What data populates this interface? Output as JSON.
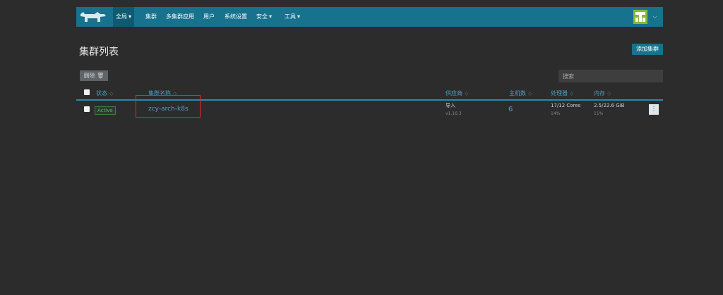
{
  "nav": {
    "items": [
      {
        "label": "全局",
        "active": true,
        "dropdown": true
      },
      {
        "label": "集群"
      },
      {
        "label": "多集群应用"
      },
      {
        "label": "用户"
      },
      {
        "label": "系统设置"
      },
      {
        "label": "安全",
        "dropdown": true
      },
      {
        "label": "工具",
        "dropdown": true
      }
    ],
    "logo_icon": "rancher-logo",
    "brand_color": "#17728d"
  },
  "page": {
    "title": "集群列表",
    "add_button": "添加集群",
    "delete_button": "删除",
    "search_placeholder": "搜索"
  },
  "table": {
    "columns": [
      "状态",
      "集群名称",
      "供应商",
      "主机数",
      "处理器",
      "内存"
    ],
    "rows": [
      {
        "status": "Active",
        "name": "zcy-arch-k8s",
        "provider": "导入",
        "version": "v1.16.3",
        "nodes": "6",
        "cpu": "17/12 Cores",
        "cpu_pct": "14%",
        "memory": "2.5/22.6 GiB",
        "memory_pct": "11%"
      }
    ]
  }
}
